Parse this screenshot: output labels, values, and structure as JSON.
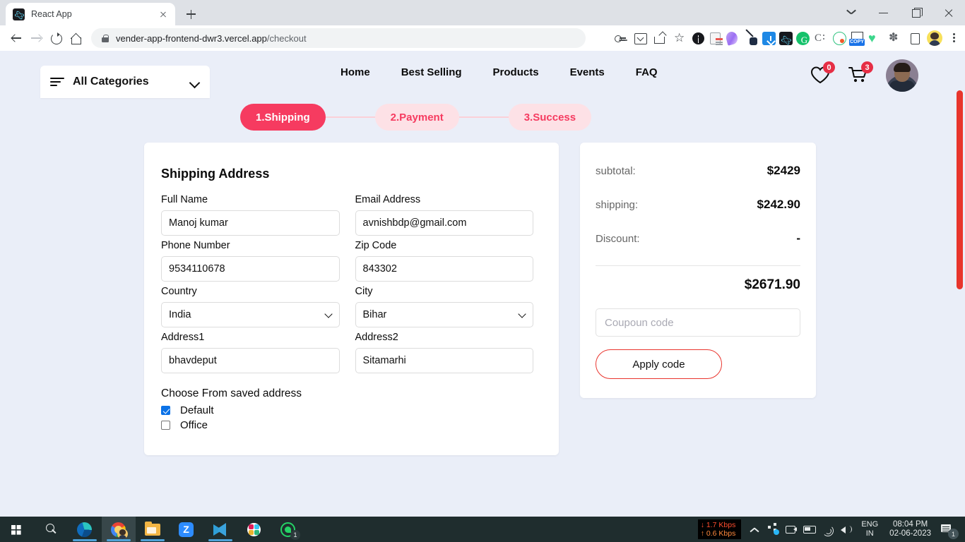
{
  "browser": {
    "tab_title": "React App",
    "url_main": "vender-app-frontend-dwr3.vercel.app",
    "url_path": "/checkout",
    "toolbar_icons": [
      "key-icon",
      "install-icon",
      "share-icon",
      "star-icon"
    ],
    "extensions": [
      "bitwarden-icon",
      "notes-icon",
      "purple-blob-icon",
      "pen-icon",
      "download-icon",
      "react-devtools-icon",
      "grammarly-icon",
      "clipboard-icon",
      "target-icon",
      "copy-icon",
      "heart-green-icon",
      "puzzle-icon",
      "side-panel-icon"
    ],
    "window_controls": [
      "tab-search-chevron",
      "minimize",
      "maximize",
      "close"
    ]
  },
  "header": {
    "categories_label": "All Categories",
    "nav": [
      {
        "label": "Home"
      },
      {
        "label": "Best Selling"
      },
      {
        "label": "Products"
      },
      {
        "label": "Events"
      },
      {
        "label": "FAQ"
      }
    ],
    "wishlist_count": "0",
    "cart_count": "3"
  },
  "steps": [
    {
      "label": "1.Shipping",
      "state": "active"
    },
    {
      "label": "2.Payment",
      "state": "idle"
    },
    {
      "label": "3.Success",
      "state": "idle"
    }
  ],
  "shipping": {
    "title": "Shipping Address",
    "fields": {
      "full_name": {
        "label": "Full Name",
        "value": "Manoj kumar"
      },
      "email": {
        "label": "Email Address",
        "value": "avnishbdp@gmail.com"
      },
      "phone": {
        "label": "Phone Number",
        "value": "9534110678"
      },
      "zip": {
        "label": "Zip Code",
        "value": "843302"
      },
      "country": {
        "label": "Country",
        "value": "India"
      },
      "city": {
        "label": "City",
        "value": "Bihar"
      },
      "address1": {
        "label": "Address1",
        "value": "bhavdeput"
      },
      "address2": {
        "label": "Address2",
        "value": "Sitamarhi"
      }
    },
    "saved_title": "Choose From saved address",
    "saved_addresses": [
      {
        "label": "Default",
        "checked": true
      },
      {
        "label": "Office",
        "checked": false
      }
    ]
  },
  "summary": {
    "rows": [
      {
        "label": "subtotal:",
        "value": "$2429"
      },
      {
        "label": "shipping:",
        "value": "$242.90"
      },
      {
        "label": "Discount:",
        "value": "-"
      }
    ],
    "total": "$2671.90",
    "coupon_placeholder": "Coupoun code",
    "coupon_value": "",
    "apply_label": "Apply code"
  },
  "colors": {
    "accent": "#f63b60",
    "accent_soft": "#fde1e6",
    "page_bg": "#eaeef8",
    "scrollbar": "#e8352c",
    "apply_border": "#e9342d",
    "badge": "#e62e45"
  },
  "taskbar": {
    "apps": [
      "start-icon",
      "search-icon",
      "edge-icon",
      "chrome-icon",
      "file-explorer-icon",
      "zoom-icon",
      "vscode-icon",
      "slack-icon",
      "whatsapp-icon"
    ],
    "whatsapp_badge": "1",
    "net_down": "1.7 Kbps",
    "net_up": "0.6 Kbps",
    "lang_line1": "ENG",
    "lang_line2": "IN",
    "time": "08:04 PM",
    "date": "02-06-2023",
    "notify_badge": "1"
  }
}
